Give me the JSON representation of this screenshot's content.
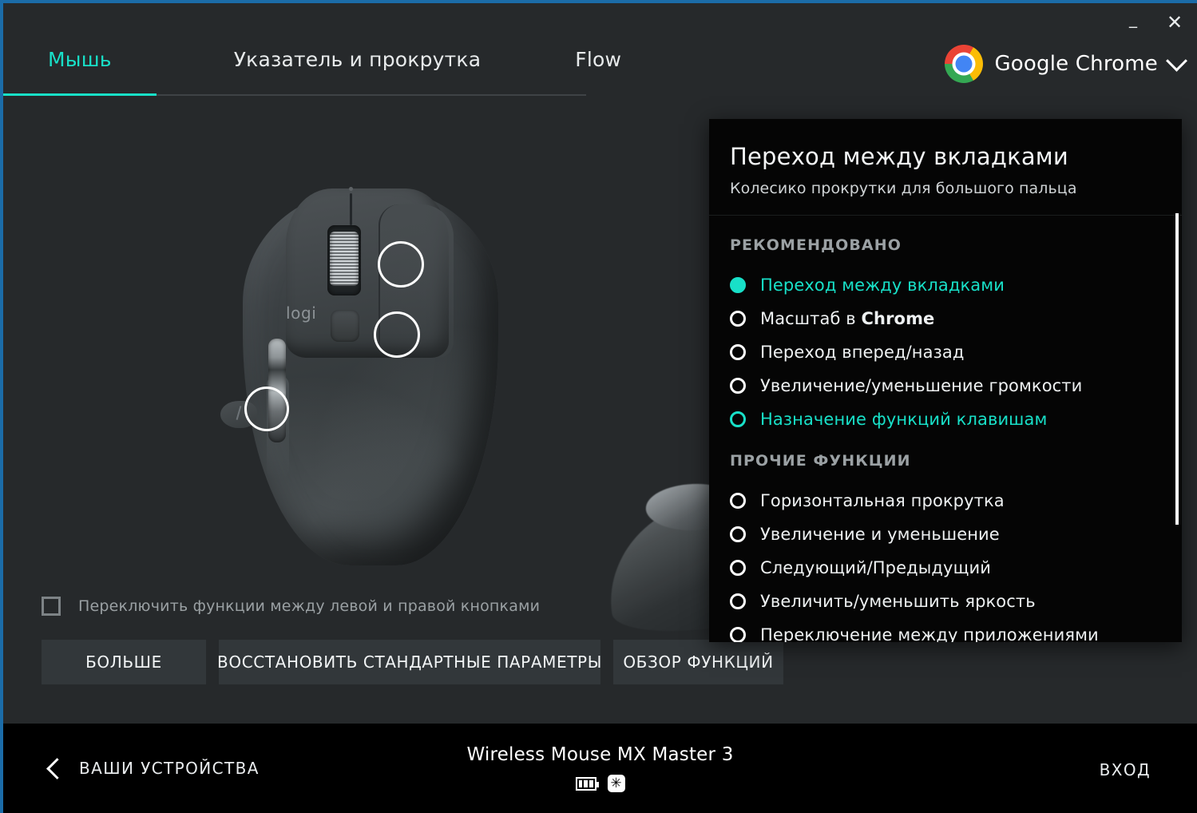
{
  "window": {
    "minimize_label": "_",
    "close_label": "✕"
  },
  "tabs": [
    {
      "label": "Мышь",
      "active": true
    },
    {
      "label": "Указатель и прокрутка",
      "active": false
    },
    {
      "label": "Flow",
      "active": false
    }
  ],
  "app_selector": {
    "icon": "chrome-logo-icon",
    "name": "Google Chrome",
    "chevron": "chevron-down-icon"
  },
  "device_preview": {
    "brand_text": "logi",
    "hotspots": [
      {
        "name": "scroll-wheel-hotspot"
      },
      {
        "name": "middle-button-hotspot"
      },
      {
        "name": "thumb-button-hotspot"
      }
    ]
  },
  "swap_buttons": {
    "checked": false,
    "label": "Переключить функции между левой и правой кнопками"
  },
  "actions": {
    "more": "БОЛЬШЕ",
    "restore": "ВОССТАНОВИТЬ СТАНДАРТНЫЕ ПАРАМЕТРЫ",
    "overview": "ОБЗОР ФУНКЦИЙ"
  },
  "panel": {
    "title": "Переход между вкладками",
    "subtitle": "Колесико прокрутки для большого пальца",
    "groups": [
      {
        "title": "РЕКОМЕНДОВАНО",
        "options": [
          {
            "label": "Переход между вкладками",
            "state": "selected"
          },
          {
            "label_html": "Масштаб в <b>Chrome</b>",
            "label": "Масштаб в Chrome",
            "state": "normal"
          },
          {
            "label": "Переход вперед/назад",
            "state": "normal"
          },
          {
            "label": "Увеличение/уменьшение громкости",
            "state": "normal"
          },
          {
            "label": "Назначение функций клавишам",
            "state": "hover"
          }
        ]
      },
      {
        "title": "ПРОЧИЕ ФУНКЦИИ",
        "options": [
          {
            "label": "Горизонтальная прокрутка",
            "state": "normal"
          },
          {
            "label": "Увеличение и уменьшение",
            "state": "normal"
          },
          {
            "label": "Следующий/Предыдущий",
            "state": "normal"
          },
          {
            "label": "Увеличить/уменьшить яркость",
            "state": "normal"
          },
          {
            "label": "Переключение между приложениями",
            "state": "normal"
          }
        ]
      }
    ]
  },
  "statusbar": {
    "back_label": "ВАШИ УСТРОЙСТВА",
    "device_name": "Wireless Mouse MX Master 3",
    "battery_icon": "battery-icon",
    "bluetooth_icon": "bluetooth-icon",
    "bluetooth_glyph": "✳",
    "signin_label": "ВХОД"
  },
  "colors": {
    "accent": "#18e0c8",
    "panel_bg": "#050505",
    "app_bg": "#26292b",
    "window_border": "#1b6ca8"
  }
}
